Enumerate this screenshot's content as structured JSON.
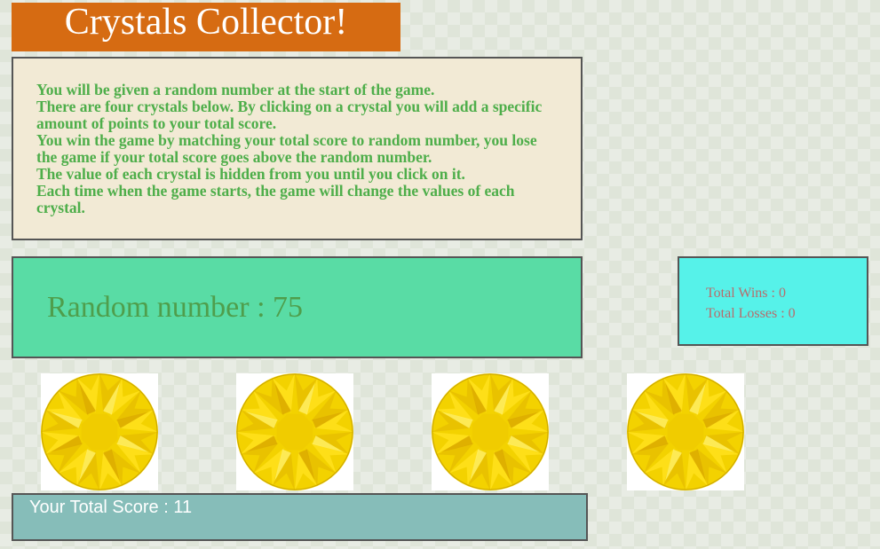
{
  "title": "Crystals Collector!",
  "instructions": [
    "You will be given a random number at the start of the game.",
    "There are four crystals below. By clicking on a crystal you will add a specific amount of points to your total score.",
    "You win the game by matching your total score to random number, you lose the game if your total score goes above the random number.",
    "The value of each crystal is hidden from you until you click on it.",
    "Each time when the game starts, the game will change the values of each crystal."
  ],
  "random_number": {
    "label": "Random number : ",
    "value": "75"
  },
  "stats": {
    "wins_label": "Total Wins : ",
    "wins": "0",
    "losses_label": "Total Losses : ",
    "losses": "0"
  },
  "crystals": [
    {
      "icon": "yellow-crystal-icon"
    },
    {
      "icon": "yellow-crystal-icon"
    },
    {
      "icon": "yellow-crystal-icon"
    },
    {
      "icon": "yellow-crystal-icon"
    }
  ],
  "score": {
    "label": "Your Total Score : ",
    "value": "11"
  },
  "colors": {
    "title_bg": "#d66b12",
    "instructions_bg": "#f2ead5",
    "instructions_text": "#4eae4a",
    "random_bg": "#59dca5",
    "random_text": "#4f9e4c",
    "stats_bg": "#56f2e9",
    "stats_text": "#b76c6c",
    "score_bg": "#86bdb9",
    "crystal": "#f3d200"
  }
}
